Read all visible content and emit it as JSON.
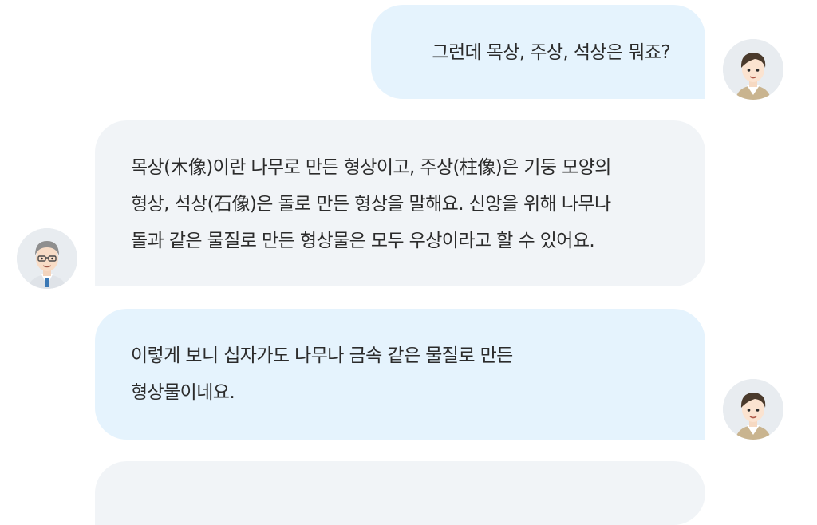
{
  "chat": {
    "messages": [
      {
        "speaker": "student",
        "avatar_icon": "student-avatar-icon",
        "lines": [
          "그런데 목상, 주상, 석상은 뭐죠?"
        ]
      },
      {
        "speaker": "teacher",
        "avatar_icon": "teacher-avatar-icon",
        "lines": [
          "목상(木像)이란 나무로 만든 형상이고, 주상(柱像)은 기둥 모양의",
          "형상, 석상(石像)은 돌로 만든 형상을 말해요. 신앙을 위해 나무나",
          "돌과 같은 물질로 만든 형상물은 모두 우상이라고 할 수 있어요."
        ]
      },
      {
        "speaker": "student",
        "avatar_icon": "student-avatar-icon",
        "lines": [
          "이렇게 보니 십자가도 나무나 금속 같은 물질로 만든",
          "형상물이네요."
        ]
      }
    ]
  },
  "colors": {
    "student_bubble": "#e5f3fd",
    "teacher_bubble": "#f1f4f7",
    "text": "#2b2b2b"
  }
}
